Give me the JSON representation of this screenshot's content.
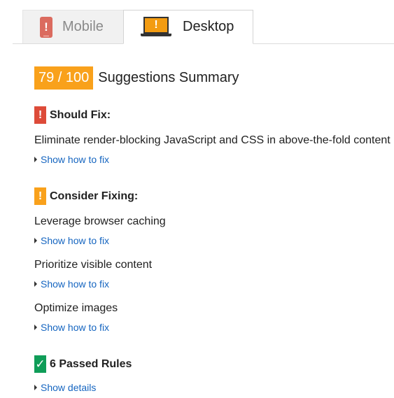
{
  "tabs": {
    "mobile": {
      "label": "Mobile",
      "icon": "phone-icon",
      "icon_mark": "!"
    },
    "desktop": {
      "label": "Desktop",
      "icon": "laptop-icon",
      "icon_mark": "!"
    }
  },
  "summary": {
    "score": "79 / 100",
    "title": "Suggestions Summary"
  },
  "should_fix": {
    "badge": "!",
    "title": "Should Fix:",
    "rules": [
      {
        "name": "Eliminate render-blocking JavaScript and CSS in above-the-fold content",
        "link": "Show how to fix"
      }
    ]
  },
  "consider_fixing": {
    "badge": "!",
    "title": "Consider Fixing:",
    "rules": [
      {
        "name": "Leverage browser caching",
        "link": "Show how to fix"
      },
      {
        "name": "Prioritize visible content",
        "link": "Show how to fix"
      },
      {
        "name": "Optimize images",
        "link": "Show how to fix"
      }
    ]
  },
  "passed": {
    "badge": "✓",
    "title": "6 Passed Rules",
    "link": "Show details"
  },
  "colors": {
    "score_orange": "#f9a11b",
    "should_fix_red": "#dd4b39",
    "passed_green": "#0f9d58",
    "link_blue": "#1565c0"
  }
}
